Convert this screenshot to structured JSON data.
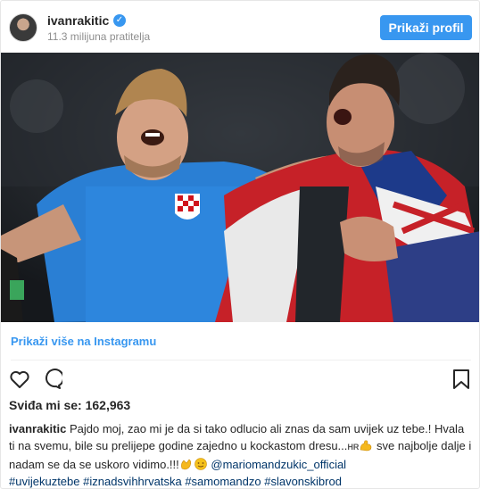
{
  "header": {
    "username": "ivanrakitic",
    "verified_icon": "verified-badge-icon",
    "followers": "11.3 milijuna pratitelja",
    "profile_button": "Prikaži profil"
  },
  "post": {
    "view_more": "Prikaži više na Instagramu",
    "likes": "Sviđa mi se: 162,963",
    "caption": {
      "username": "ivanrakitic",
      "text1": "Pajdo moj, zao mi je da si tako odlucio ali znas da sam uvijek uz tebe.! Hvala ti na svemu, bile su prelijepe godine zajedno u kockastom dresu...",
      "flag": "HR",
      "text2": "sve najbolje dalje i nadam se da se uskoro vidimo.!!!",
      "mention": "@mariomandzukic_official",
      "tags": [
        "#uvijekuztebe",
        "#iznadsvihhrvatska",
        "#samomandzo",
        "#slavonskibrod"
      ]
    }
  },
  "colors": {
    "accent": "#3897f0",
    "link": "#003569",
    "muted": "#8e8e8e"
  }
}
